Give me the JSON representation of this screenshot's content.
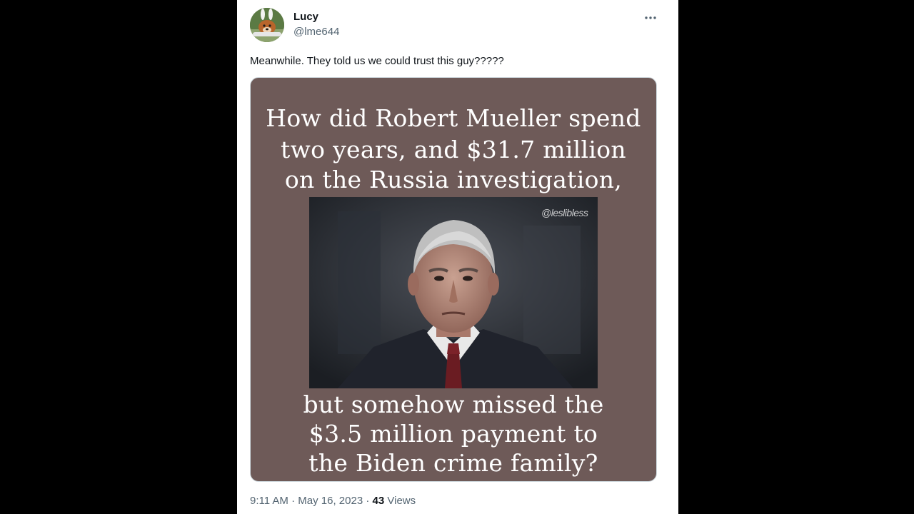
{
  "tweet": {
    "author": {
      "display_name": "Lucy",
      "handle": "@lme644",
      "avatar_icon": "dog-with-bunny-ears-avatar"
    },
    "more_icon": "more-options-icon",
    "text": "Meanwhile. They told us we could trust this guy?????",
    "media": {
      "background_color": "#6e5a58",
      "top_lines": [
        "How did Robert Mueller spend",
        "two years, and $31.7 million",
        "on the Russia investigation,"
      ],
      "watermark": "@leslibless",
      "bottom_lines": [
        "but somehow missed the",
        "$3.5 million payment to",
        "the Biden crime family?"
      ]
    },
    "meta": {
      "time": "9:11 AM",
      "separator": "·",
      "date": "May 16, 2023",
      "views_count": "43",
      "views_label": "Views"
    }
  }
}
